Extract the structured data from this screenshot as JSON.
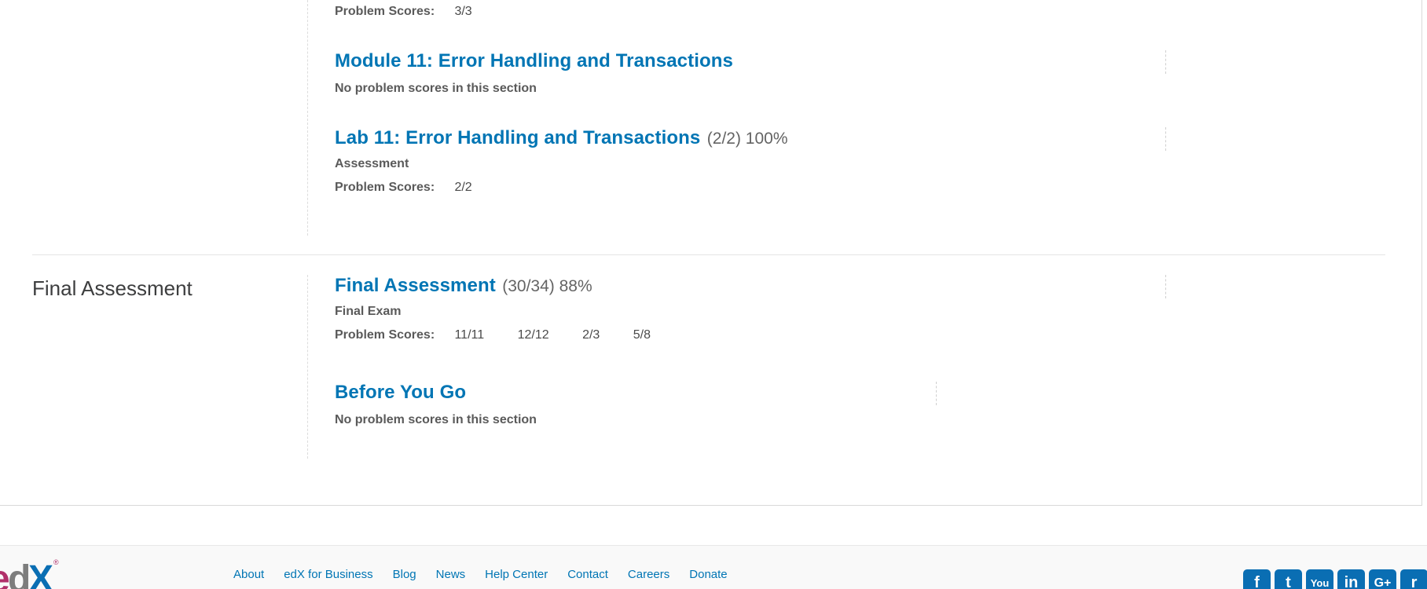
{
  "chapters": [
    {
      "title": "",
      "sections": [
        {
          "title": "",
          "score": "",
          "subtitle": "",
          "scores_label": "Problem Scores:",
          "scores": [
            "3/3"
          ]
        },
        {
          "title": "Module 11: Error Handling and Transactions",
          "score": "",
          "subtitle": "No problem scores in this section"
        },
        {
          "title": "Lab 11: Error Handling and Transactions",
          "score": "(2/2) 100%",
          "subtitle": "Assessment",
          "scores_label": "Problem Scores:",
          "scores": [
            "2/2"
          ]
        }
      ]
    },
    {
      "title": "Final Assessment",
      "sections": [
        {
          "title": "Final Assessment",
          "score": "(30/34) 88%",
          "subtitle": "Final Exam",
          "scores_label": "Problem Scores:",
          "scores": [
            "11/11",
            "12/12",
            "2/3",
            "5/8"
          ]
        },
        {
          "title": "Before You Go",
          "score": "",
          "subtitle": "No problem scores in this section"
        }
      ]
    }
  ],
  "footer": {
    "logo_text": "edX",
    "logo_registered": "®",
    "links": [
      "About",
      "edX for Business",
      "Blog",
      "News",
      "Help Center",
      "Contact",
      "Careers",
      "Donate"
    ],
    "social": [
      {
        "icon": "facebook-icon",
        "glyph": "f"
      },
      {
        "icon": "twitter-icon",
        "glyph": "t"
      },
      {
        "icon": "youtube-icon",
        "glyph": "You"
      },
      {
        "icon": "linkedin-icon",
        "glyph": "in"
      },
      {
        "icon": "google-plus-icon",
        "glyph": "G+"
      },
      {
        "icon": "reddit-icon",
        "glyph": "r"
      }
    ]
  },
  "colors": {
    "link": "#0075b4",
    "text": "#414141",
    "social": "#0a6eb3",
    "logo_magenta": "#b0306a",
    "logo_blue": "#0a6eb3"
  }
}
